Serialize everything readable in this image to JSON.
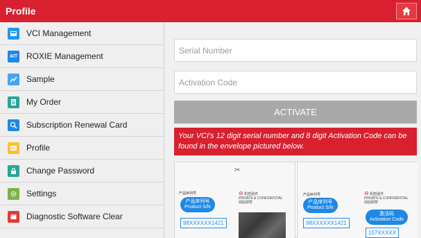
{
  "header": {
    "title": "Profile",
    "home_icon": "home-icon",
    "background": "#d8202e"
  },
  "sidebar": {
    "items": [
      {
        "label": "VCI Management",
        "icon": "vci-icon",
        "color": "#2196f3"
      },
      {
        "label": "ROXIE Management",
        "icon": "roxie-icon",
        "color": "#1e88e5",
        "icon_text": "AIT"
      },
      {
        "label": "Sample",
        "icon": "sample-chart-icon",
        "color": "#42a5f5"
      },
      {
        "label": "My Order",
        "icon": "order-list-icon",
        "color": "#26a69a"
      },
      {
        "label": "Subscription Renewal Card",
        "icon": "search-card-icon",
        "color": "#1e88e5"
      },
      {
        "label": "Profile",
        "icon": "profile-card-icon",
        "color": "#fbc02d"
      },
      {
        "label": "Change Password",
        "icon": "lock-icon",
        "color": "#26a69a"
      },
      {
        "label": "Settings",
        "icon": "gear-icon",
        "color": "#7cb342"
      },
      {
        "label": "Diagnostic Software Clear",
        "icon": "clear-icon",
        "color": "#e53935"
      }
    ]
  },
  "form": {
    "serial_placeholder": "Serial Number",
    "activation_placeholder": "Activation Code",
    "activate_label": "ACTIVATE"
  },
  "notice": {
    "text": "Your VCI's 12 digit serial number and 8 digit Activation Code can be found in the envelope pictured below."
  },
  "envelope_left": {
    "cut_mark": "✂",
    "header_cn": "产品序列号",
    "bubble_cn": "产品序列号",
    "bubble_en": "Product S/N",
    "serial_value": "98XXXXXX1421",
    "seal_cn": "机密函件",
    "seal_en": "PRIVATE & CONFIDENTIAL",
    "seal_sub": "阅后即焚"
  },
  "envelope_right": {
    "header_cn": "产品序列号",
    "bubble_cn": "产品序列号",
    "bubble_en": "Product S/N",
    "serial_value": "98XXXXXX1421",
    "seal_cn": "机密函件",
    "seal_en": "PRIVATE & CONFIDENTIAL",
    "seal_sub": "阅后即焚",
    "activation_bubble_cn": "激活码",
    "activation_bubble_en": "Activation Code",
    "activation_value": "157XXXXX"
  }
}
